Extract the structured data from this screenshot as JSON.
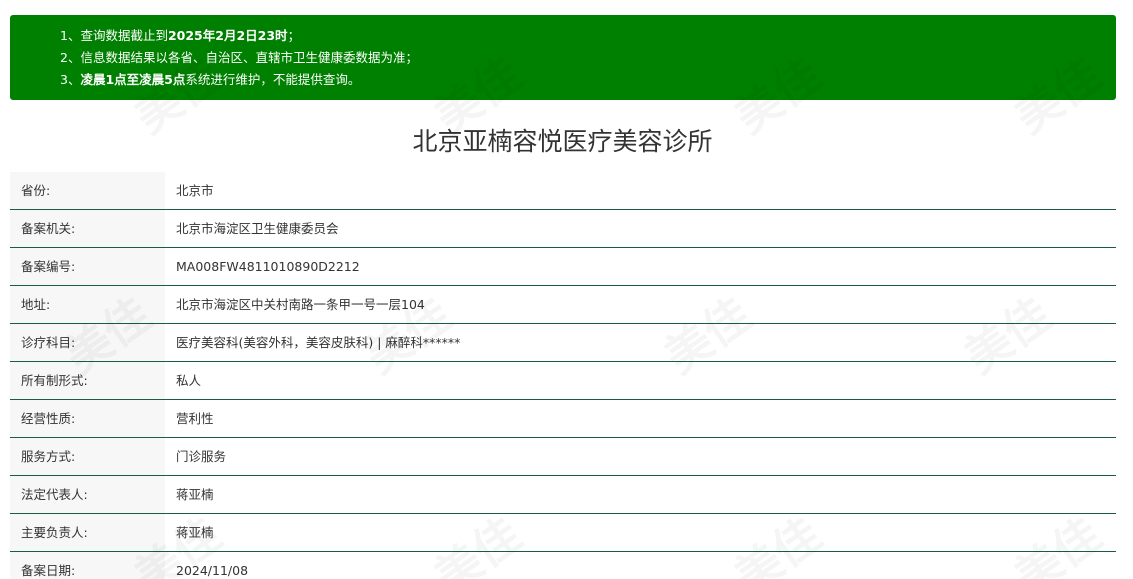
{
  "notice": {
    "line1_prefix": "1、查询数据截止到",
    "line1_bold": "2025年2月2日23时",
    "line1_suffix": "；",
    "line2": "2、信息数据结果以各省、自治区、直辖市卫生健康委数据为准；",
    "line3_prefix": "3、",
    "line3_bold": "凌晨1点至凌晨5点",
    "line3_suffix": "系统进行维护，不能提供查询。"
  },
  "title": "北京亚楠容悦医疗美容诊所",
  "rows": [
    {
      "label": "省份:",
      "value": "北京市"
    },
    {
      "label": "备案机关:",
      "value": "北京市海淀区卫生健康委员会"
    },
    {
      "label": "备案编号:",
      "value": "MA008FW4811010890D2212"
    },
    {
      "label": "地址:",
      "value": "北京市海淀区中关村南路一条甲一号一层104"
    },
    {
      "label": "诊疗科目:",
      "value": "医疗美容科(美容外科，美容皮肤科) | 麻醉科******"
    },
    {
      "label": "所有制形式:",
      "value": "私人"
    },
    {
      "label": "经营性质:",
      "value": "营利性"
    },
    {
      "label": "服务方式:",
      "value": "门诊服务"
    },
    {
      "label": "法定代表人:",
      "value": "蒋亚楠"
    },
    {
      "label": "主要负责人:",
      "value": "蒋亚楠"
    },
    {
      "label": "备案日期:",
      "value": "2024/11/08"
    }
  ],
  "watermark_text": "美佳",
  "colors": {
    "notice_bg": "#008000",
    "row_border": "#1a5a4a",
    "label_bg": "#f7f7f7"
  }
}
